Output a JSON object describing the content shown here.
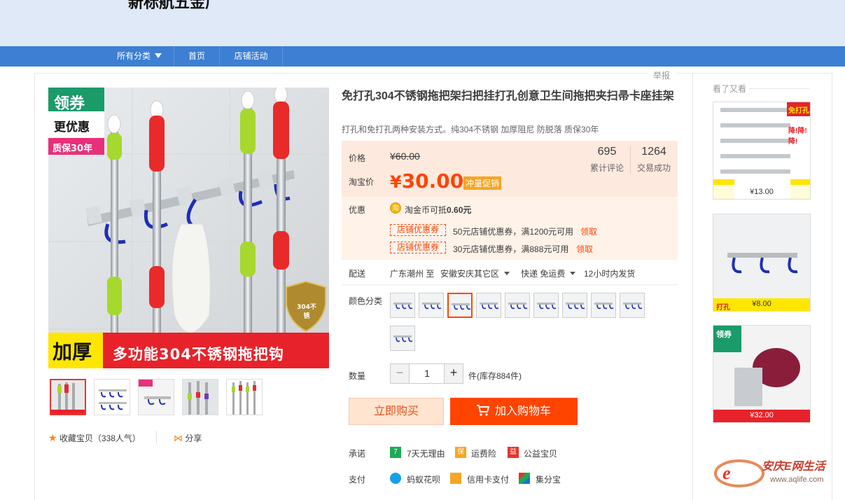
{
  "shop": {
    "name": "新标航五金厂"
  },
  "nav": {
    "all_categories": "所有分类",
    "home": "首页",
    "activity": "店铺活动"
  },
  "report_label": "举报",
  "product": {
    "title": "免打孔304不锈钢拖把架扫把挂打孔创意卫生间拖把夹扫帚卡座挂架",
    "subtitle": "打孔和免打孔两种安装方式。纯304不锈钢 加厚阻尼 防脱落 质保30年"
  },
  "main_image": {
    "badge_line1": "领券",
    "badge_line2": "更优惠",
    "badge_line3": "质保30年",
    "banner_left": "加厚",
    "banner_right": "多功能304不锈钢拖把钩",
    "shield": "304不锈"
  },
  "price": {
    "orig_label": "价格",
    "orig_value": "¥60.00",
    "taobao_label": "淘宝价",
    "currency": "¥",
    "current_value": "30.00",
    "promo_tag": "冲量促销",
    "reviews_count": "695",
    "reviews_label": "累计评论",
    "sales_count": "1264",
    "sales_label": "交易成功"
  },
  "offers": {
    "label": "优惠",
    "coin_icon_text": "淘",
    "coin_text": "淘金币可抵",
    "coin_value": "0.60元",
    "coupons": [
      {
        "tag": "店铺优惠券",
        "text": "50元店铺优惠券，满1200元可用",
        "action": "领取"
      },
      {
        "tag": "店铺优惠券",
        "text": "30元店铺优惠券，满888元可用",
        "action": "领取"
      }
    ]
  },
  "delivery": {
    "label": "配送",
    "from": "广东潮州 至",
    "to": "安徽安庆其它区",
    "shipping": "快递 免运费",
    "dispatch": "12小时内发货"
  },
  "color": {
    "label": "颜色分类",
    "selected_index": 2,
    "count": 10
  },
  "quantity": {
    "label": "数量",
    "minus": "−",
    "value": "1",
    "plus": "+",
    "stock_text": "件(库存884件)"
  },
  "buttons": {
    "buy_now": "立即购买",
    "add_to_cart": "加入购物车"
  },
  "promise": {
    "label": "承诺",
    "items": [
      {
        "icon_text": "7",
        "text": "7天无理由"
      },
      {
        "icon_text": "保",
        "text": "运费险"
      },
      {
        "icon_text": "益",
        "text": "公益宝贝"
      }
    ]
  },
  "payment": {
    "label": "支付",
    "items": [
      {
        "text": "蚂蚁花呗"
      },
      {
        "text": "信用卡支付"
      },
      {
        "text": "集分宝"
      }
    ]
  },
  "actions": {
    "favorite": "收藏宝贝（338人气）",
    "share": "分享"
  },
  "sidebar": {
    "title": "看了又看",
    "items": [
      {
        "price": "¥13.00",
        "badge": "免打孔",
        "sub_badge": "降!降!降!"
      },
      {
        "price": "¥8.00",
        "badge": "打孔"
      },
      {
        "price": "¥32.00",
        "badge": "领券"
      }
    ]
  },
  "watermark": {
    "text": "安庆E网生活",
    "url": "www.aqlife.com"
  },
  "colors": {
    "accent": "#ff4400",
    "nav": "#3d7fd2",
    "banner": "#dfe9f7",
    "price_bg": "#fff2e8"
  }
}
